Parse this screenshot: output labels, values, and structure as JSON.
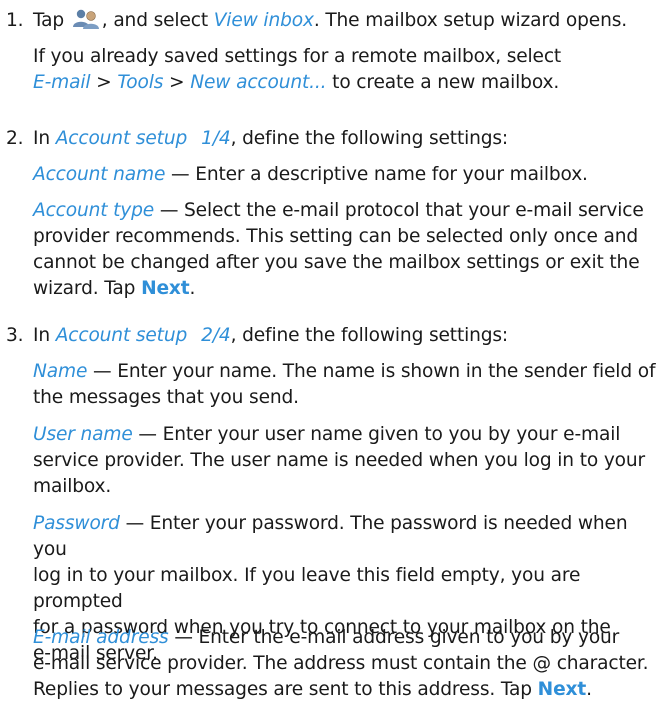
{
  "steps": [
    {
      "number": "1.",
      "line1_tap": "Tap",
      "line1_icon": "contacts-icon",
      "line1_mid": ", and select",
      "line1_link": "View inbox",
      "line1_end": ". The mailbox setup wizard opens.",
      "note_line1": "If you already saved settings for a remote mailbox, select",
      "note_menu1": "E-mail",
      "note_sep1": " > ",
      "note_menu2": "Tools",
      "note_sep2": " > ",
      "note_menu3": "New account...",
      "note_end": " to create a new mailbox."
    },
    {
      "number": "2.",
      "intro_pre": "In ",
      "intro_screen": "Account setup",
      "intro_page": "1/4",
      "intro_post": ", define the following settings:",
      "setting1_name": "Account name",
      "setting1_desc": " — Enter a descriptive name for your mailbox.",
      "setting2_name": "Account type",
      "setting2_desc_l1": " — Select the e-mail protocol that your e-mail service",
      "setting2_desc_l2": "provider recommends. This setting can be selected only once and",
      "setting2_desc_l3": "cannot be changed after you save the mailbox settings or exit the",
      "setting2_desc_l4_pre": "wizard. Tap ",
      "setting2_button": "Next",
      "setting2_desc_l4_post": "."
    },
    {
      "number": "3.",
      "intro_pre": "In ",
      "intro_screen": "Account setup",
      "intro_page": "2/4",
      "intro_post": ", define the following settings:",
      "setting1_name": "Name",
      "setting1_desc_l1": " — Enter your name. The name is shown in the sender field of",
      "setting1_desc_l2": "the messages that you send.",
      "setting2_name": "User name",
      "setting2_desc_l1": " — Enter your user name given to you by your e-mail",
      "setting2_desc_l2": "service provider. The user name is needed when you log in to your",
      "setting2_desc_l3": "mailbox.",
      "setting3_name": "Password",
      "setting3_desc_l1": " — Enter your password. The password is needed when you",
      "setting3_desc_l2": "log in to your mailbox. If you leave this field empty, you are prompted",
      "setting3_desc_l3": "for a password when you try to connect to your mailbox on the",
      "setting3_desc_l4": "e-mail server.",
      "setting4_name": "E-mail address",
      "setting4_desc_l1": " — Enter the e-mail address given to you by your",
      "setting4_desc_l2": "e-mail service provider. The address must contain the @ character.",
      "setting4_desc_l3_pre": "Replies to your messages are sent to this address. Tap ",
      "setting4_button": "Next",
      "setting4_desc_l3_post": "."
    }
  ],
  "colors": {
    "link": "#2f8fd8",
    "text": "#1a1a1a"
  }
}
